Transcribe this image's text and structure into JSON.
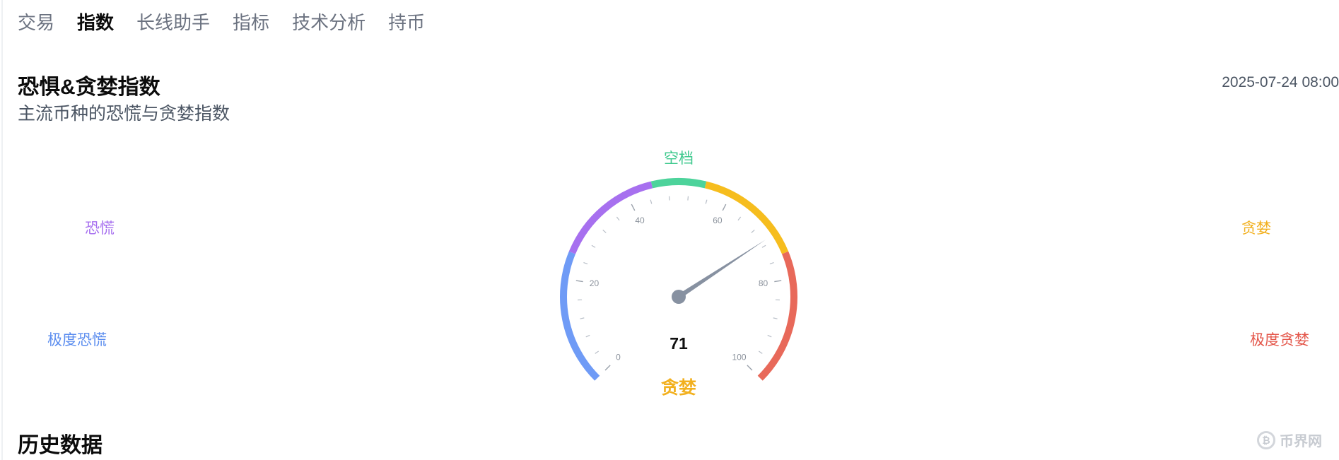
{
  "tabs": [
    {
      "label": "交易",
      "active": false
    },
    {
      "label": "指数",
      "active": true
    },
    {
      "label": "长线助手",
      "active": false
    },
    {
      "label": "指标",
      "active": false
    },
    {
      "label": "技术分析",
      "active": false
    },
    {
      "label": "持币",
      "active": false
    }
  ],
  "header": {
    "title": "恐惧&贪婪指数",
    "subtitle": "主流币种的恐慌与贪婪指数",
    "timestamp": "2025-07-24 08:00"
  },
  "zones": {
    "extreme_fear": {
      "label": "极度恐慌",
      "color": "#5b8def"
    },
    "fear": {
      "label": "恐慌",
      "color": "#a770ef"
    },
    "neutral": {
      "label": "空档",
      "color": "#3fc98e"
    },
    "greed": {
      "label": "贪婪",
      "color": "#f2b01e"
    },
    "extreme_greed": {
      "label": "极度贪婪",
      "color": "#e4574b"
    }
  },
  "gauge": {
    "min": 0,
    "max": 100,
    "value": 71,
    "value_text": "71",
    "status_text": "贪婪",
    "status_color": "#f2b01e",
    "tick_labels": [
      "0",
      "20",
      "40",
      "60",
      "80",
      "100"
    ],
    "segments": [
      {
        "from": 0,
        "to": 25,
        "color": "#6f9bf6"
      },
      {
        "from": 25,
        "to": 45,
        "color": "#a770ef"
      },
      {
        "from": 45,
        "to": 55,
        "color": "#4dd39b"
      },
      {
        "from": 55,
        "to": 75,
        "color": "#f6bd1e"
      },
      {
        "from": 75,
        "to": 100,
        "color": "#e8695a"
      }
    ],
    "needle_color": "#8791a1"
  },
  "history": {
    "title": "历史数据"
  },
  "watermark": {
    "icon": "bitcoin-circle-icon",
    "glyph": "₿",
    "text": "币界网"
  }
}
